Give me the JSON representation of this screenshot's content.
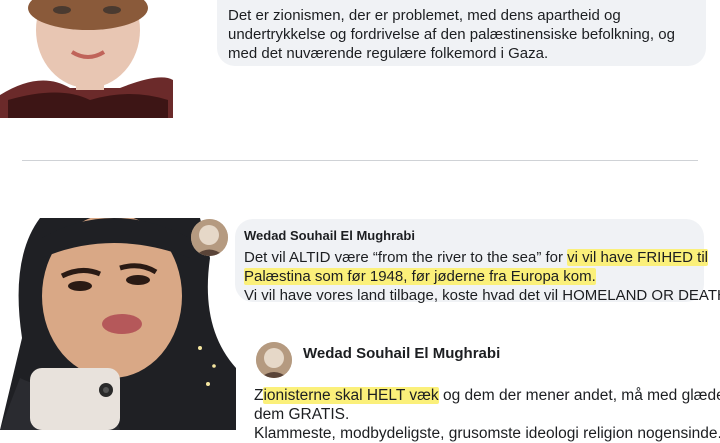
{
  "top_comment": {
    "lines": [
      "Det er zionismen, der er problemet, med dens apartheid og",
      "undertrykkelse og fordrivelse af den palæstinensiske befolkning, og",
      "med det nuværende regulære folkemord i Gaza."
    ]
  },
  "second_comment": {
    "author": "Wedad Souhail El Mughrabi",
    "line1_plain": "Det vil ALTID være “from the river to the sea” for ",
    "line1_highlight": "vi vil have FRIHED til",
    "line2_highlight": "Palæstina som før 1948, før jøderne fra Europa kom.",
    "line3": "Vi vil have vores land tilbage, koste hvad det vil HOMELAND OR DEATH."
  },
  "post": {
    "author": "Wedad Souhail El Mughrabi",
    "line1_first": "Z",
    "line1_highlight": "ionisterne skal HELT væk",
    "line1_rest": " og dem der mener andet, må med glæde få",
    "line2": "dem GRATIS.",
    "line3": "Klammeste, modbydeligste, grusomste ideologi religion nogensinde."
  },
  "colors": {
    "bubble_bg": "#f0f2f5",
    "highlight": "#fbf07a",
    "divider": "#cfd2d6"
  }
}
